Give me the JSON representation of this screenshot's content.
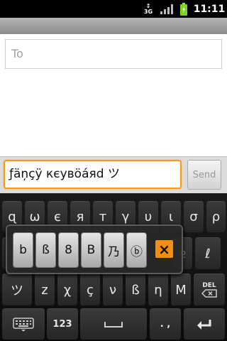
{
  "status_bar": {
    "network": "3G",
    "time": "11:11",
    "icons": [
      "3g-icon",
      "signal-icon",
      "battery-icon"
    ]
  },
  "compose": {
    "to_placeholder": "To",
    "message_text": "ƒäņçÿ кєувöáяd ツ",
    "send_label": "Send"
  },
  "keyboard": {
    "row1": [
      "ɋ",
      "ω",
      "є",
      "я",
      "т",
      "γ",
      "υ",
      "ι",
      "σ",
      "ρ"
    ],
    "row2_visible": [
      "ɐ",
      "ℓ"
    ],
    "row3": [
      "ツ",
      "z",
      "χ",
      "ç",
      "ν",
      "ß",
      "η",
      "M"
    ],
    "del_label": "DEL",
    "num_label": "123",
    "punct_label": ". ,"
  },
  "popup": {
    "keys": [
      "b",
      "ß",
      "8",
      "B",
      "乃",
      "ⓑ"
    ],
    "close_symbol": "×"
  }
}
